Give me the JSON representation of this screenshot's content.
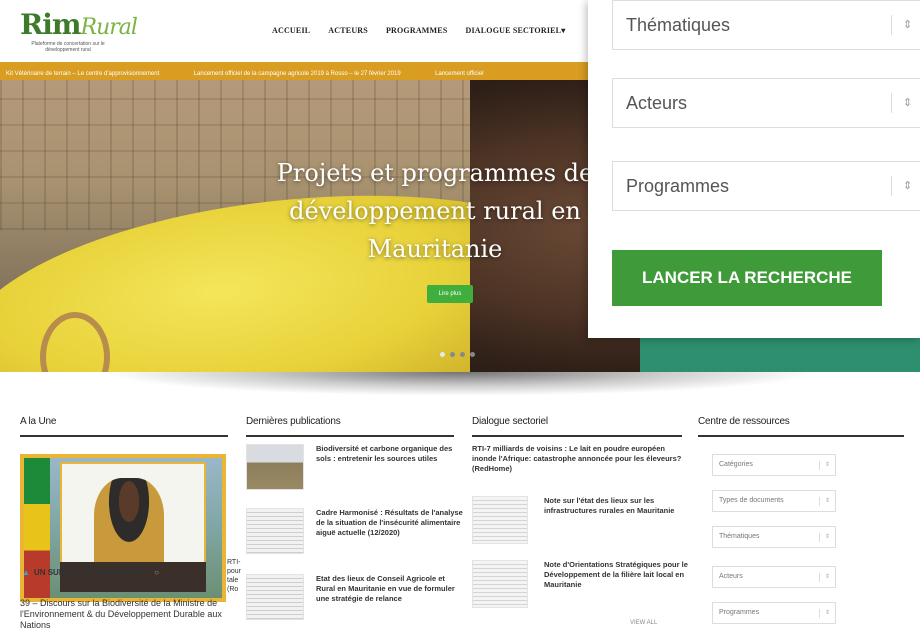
{
  "header": {
    "logo_main": "Rim",
    "logo_accent": "Rural",
    "logo_sub": "Plateforme de concertation sur le développement rural",
    "nav": [
      "ACCUEIL",
      "ACTEURS",
      "PROGRAMMES",
      "DIALOGUE SECTORIEL▾"
    ]
  },
  "ticker": [
    "Kit Vétérinaire de terrain – Le centre d'approvisionnement",
    "Lancement officiel de la campagne agricole 2019 à Rosso – le 27 février 2019",
    "Lancement officiel"
  ],
  "hero": {
    "title": "Projets et programmes de développement rural en Mauritanie",
    "button": "Lire plus",
    "slides": 4,
    "active_slide": 0
  },
  "search": {
    "selects": [
      "Thématiques",
      "Acteurs",
      "Programmes"
    ],
    "arrow": "⇕",
    "submit": "LANCER LA RECHERCHE"
  },
  "une": {
    "heading": "A la Une",
    "caption": "UN SUMMIT ON BIODIVERSITY",
    "text": "39 – Discours sur la Biodiversité de la Ministre de l'Environnement & du Développement Durable aux Nations",
    "side": "RTI-pour tale (Ro"
  },
  "publications": {
    "heading": "Dernières publications",
    "items": [
      "Biodiversité et carbone organique des sols : entretenir les sources utiles",
      "Cadre Harmonisé : Résultats de l'analyse de la situation de l'insécurité alimentaire aiguë actuelle (12/2020)",
      "Etat des lieux de Conseil Agricole et Rural en Mauritanie en vue de formuler une stratégie de relance"
    ]
  },
  "dialogue": {
    "heading": "Dialogue sectoriel",
    "lead": "RTI-7 milliards de voisins : Le lait en poudre européen inonde l'Afrique: catastrophe annoncée pour les éleveurs? (RedHome)",
    "items": [
      "Note sur l'état des lieux sur les infrastructures rurales en Mauritanie",
      "Note d'Orientations Stratégiques pour le Développement de la filière lait local en Mauritanie"
    ],
    "more": "VIEW ALL"
  },
  "resources": {
    "heading": "Centre de ressources",
    "selects": [
      "Catégories",
      "Types de documents",
      "Thématiques",
      "Acteurs",
      "Programmes"
    ],
    "arrow": "⇕"
  },
  "colors": {
    "brand_green": "#3f9b3a",
    "ticker": "#d99d22",
    "frame_gold": "#e8b634"
  }
}
